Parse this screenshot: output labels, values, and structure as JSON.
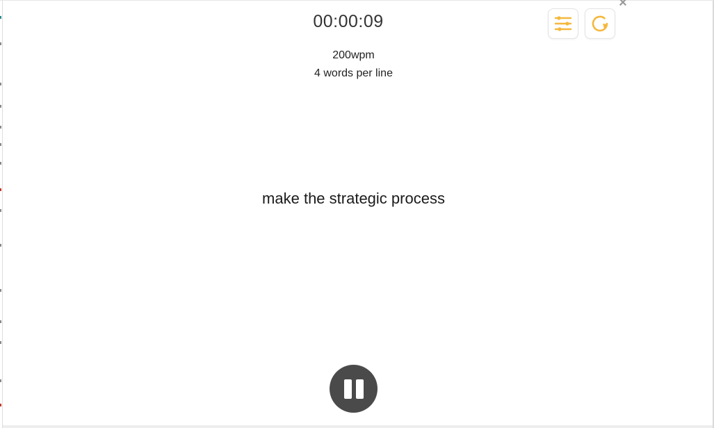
{
  "timer": "00:00:09",
  "speed": "200wpm",
  "words_per_line": "4 words per line",
  "current_line": "make the strategic process",
  "controls": {
    "settings_icon": "sliders-icon",
    "restart_icon": "restart-icon",
    "close_icon": "close-icon",
    "close_glyph": "×",
    "pause_icon": "pause-icon"
  },
  "colors": {
    "accent": "#f5b83d",
    "pause_button": "#4a4a4a"
  }
}
